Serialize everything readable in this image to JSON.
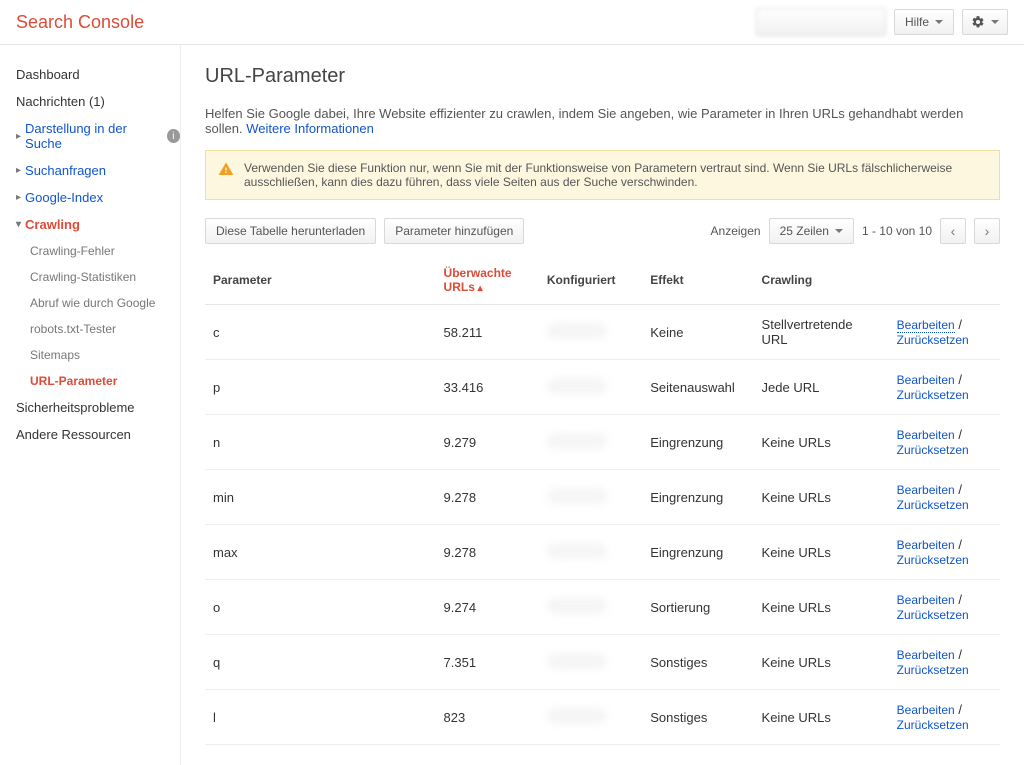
{
  "header": {
    "logo": "Search Console",
    "help_label": "Hilfe"
  },
  "sidebar": {
    "dashboard": "Dashboard",
    "messages": "Nachrichten (1)",
    "appearance": "Darstellung in der Suche",
    "search_queries": "Suchanfragen",
    "google_index": "Google-Index",
    "crawling": "Crawling",
    "crawling_sub": {
      "errors": "Crawling-Fehler",
      "stats": "Crawling-Statistiken",
      "fetch": "Abruf wie durch Google",
      "robots": "robots.txt-Tester",
      "sitemaps": "Sitemaps",
      "url_params": "URL-Parameter"
    },
    "security": "Sicherheitsprobleme",
    "other": "Andere Ressourcen"
  },
  "main": {
    "title": "URL-Parameter",
    "description": "Helfen Sie Google dabei, Ihre Website effizienter zu crawlen, indem Sie angeben, wie Parameter in Ihren URLs gehandhabt werden sollen.",
    "more_info": "Weitere Informationen",
    "alert": "Verwenden Sie diese Funktion nur, wenn Sie mit der Funktionsweise von Parametern vertraut sind. Wenn Sie URLs fälschlicherweise ausschließen, kann dies dazu führen, dass viele Seiten aus der Suche verschwinden.",
    "download_btn": "Diese Tabelle herunterladen",
    "add_btn": "Parameter hinzufügen",
    "show_label": "Anzeigen",
    "rows_select": "25 Zeilen",
    "pagination": "1 - 10 von 10",
    "columns": {
      "param": "Parameter",
      "monitored": "Überwachte URLs",
      "configured": "Konfiguriert",
      "effect": "Effekt",
      "crawling": "Crawling"
    },
    "action_edit": "Bearbeiten",
    "action_reset": "Zurücksetzen",
    "rows": [
      {
        "param": "c",
        "urls": "58.211",
        "effect": "Keine",
        "crawling": "Stellvertretende URL"
      },
      {
        "param": "p",
        "urls": "33.416",
        "effect": "Seitenauswahl",
        "crawling": "Jede URL"
      },
      {
        "param": "n",
        "urls": "9.279",
        "effect": "Eingrenzung",
        "crawling": "Keine URLs"
      },
      {
        "param": "min",
        "urls": "9.278",
        "effect": "Eingrenzung",
        "crawling": "Keine URLs"
      },
      {
        "param": "max",
        "urls": "9.278",
        "effect": "Eingrenzung",
        "crawling": "Keine URLs"
      },
      {
        "param": "o",
        "urls": "9.274",
        "effect": "Sortierung",
        "crawling": "Keine URLs"
      },
      {
        "param": "q",
        "urls": "7.351",
        "effect": "Sonstiges",
        "crawling": "Keine URLs"
      },
      {
        "param": "l",
        "urls": "823",
        "effect": "Sonstiges",
        "crawling": "Keine URLs"
      }
    ]
  }
}
